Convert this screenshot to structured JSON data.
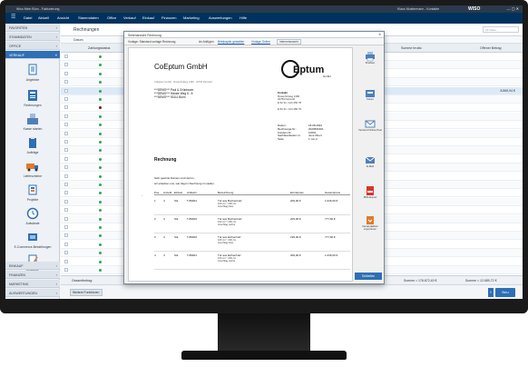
{
  "window": {
    "title": "Wiso Mein Büro - Fakturierung",
    "user": "Klaus Mustermann - Kontakte",
    "brand": "WISO",
    "controls": "— ▢ ✕"
  },
  "menu": [
    "Datei",
    "Aktuell",
    "Ansicht",
    "Stammdaten",
    "Office",
    "Verkauf",
    "Einkauf",
    "Finanzen",
    "Marketing",
    "Auswertungen",
    "Hilfe"
  ],
  "sidebar": {
    "sections": [
      "FAVORITEN",
      "STAMMDATEN",
      "OFFICE",
      "VERKAUF",
      "EINKAUF",
      "FINANZEN",
      "MARKETING",
      "AUSWERTUNGEN"
    ],
    "items": [
      "Angebote",
      "Rechnungen",
      "Kasse starten",
      "Aufträge",
      "Lieferscheine",
      "Projekte",
      "Aufwände",
      "E-Commerce-Bestellungen",
      "Entwurfe"
    ]
  },
  "main": {
    "title": "Rechnungen",
    "search_placeholder": "Alt-Taste...",
    "columns": [
      "Datum",
      "Zahlungsstatus",
      "Summe brutto",
      "Offener Betrag"
    ],
    "rows": [
      {
        "a1": "",
        "a2": ""
      },
      {
        "a1": "",
        "a2": ""
      },
      {
        "a1": "",
        "a2": ""
      },
      {
        "a1": "",
        "a2": ""
      },
      {
        "a1": "",
        "a2": "8.869,94 €"
      },
      {
        "a1": "",
        "a2": ""
      },
      {
        "a1": "",
        "a2": ""
      },
      {
        "a1": "",
        "a2": ""
      },
      {
        "a1": "",
        "a2": ""
      },
      {
        "a1": "",
        "a2": ""
      },
      {
        "a1": "",
        "a2": ""
      },
      {
        "a1": "",
        "a2": ""
      },
      {
        "a1": "",
        "a2": ""
      },
      {
        "a1": "",
        "a2": ""
      },
      {
        "a1": "",
        "a2": ""
      },
      {
        "a1": "",
        "a2": ""
      },
      {
        "a1": "",
        "a2": ""
      },
      {
        "a1": "",
        "a2": ""
      },
      {
        "a1": "",
        "a2": ""
      },
      {
        "a1": "",
        "a2": ""
      },
      {
        "a1": "",
        "a2": ""
      },
      {
        "a1": "",
        "a2": ""
      },
      {
        "a1": "",
        "a2": ""
      },
      {
        "a1": "",
        "a2": ""
      },
      {
        "a1": "",
        "a2": ""
      },
      {
        "a1": "",
        "a2": ""
      }
    ],
    "footer_left": "Gesamtbetrag:",
    "footer_sum1": "Summe = 176.672,40 €",
    "footer_sum2": "Summe = 12.689,72 €",
    "more_functions": "Weitere Funktionen",
    "new_button": "Neu"
  },
  "modal": {
    "title": "Seitenansicht Rechnung",
    "close": "✕",
    "toolbar": {
      "template_label": "Vorlage: Standard-vorlage Rechnung",
      "attachments": "An Anfügen",
      "link1": "Briefpapier gestalten",
      "link2": "Vorlage Online",
      "view_select": "Internetansicht"
    },
    "doc": {
      "company": "CoEptum GmbH",
      "logo_text": "Eptum",
      "logo_sub": "GmbH",
      "sender_line": "CoEptum GmbH · Rosenhofweg 1396 · 32760 Detmold",
      "address": [
        "***DEMO*** Paul & Grünbaum",
        "***DEMO*** Hänsle Weg 8 - 8",
        "***DEMO*** 53111 Bonn"
      ],
      "contact_title": "Kontakt:",
      "contact_lines": [
        "Rosenhofweg 1396",
        "32760 Detmold",
        "E 52 31 / 123 456 78",
        "",
        "E 52 31 / 123 456 79"
      ],
      "meta": [
        {
          "k": "Datum:",
          "v": "18.08.2022"
        },
        {
          "k": "Rechnungs-Nr.:",
          "v": "2020501601"
        },
        {
          "k": "Kunden-Nr.:",
          "v": "10001"
        },
        {
          "k": "Sachbearbeiter/-in:",
          "v": "Jens Oberl"
        },
        {
          "k": "Seite",
          "v": "1 von 2"
        }
      ],
      "heading": "Rechnung",
      "salutation": "Sehr geehrte Damen und Herren,",
      "intro": "wir erlauben uns, wie folgt in Rechnung zu stellen.",
      "table_headers": [
        "Pos.",
        "Anzahl",
        "Einheit",
        "Artikelnr.",
        "Bezeichnung",
        "Einzelpreis",
        "Gesamtpreis"
      ],
      "lines": [
        {
          "pos": "1",
          "qty": "4",
          "unit": "Stk",
          "art": "T-89001",
          "desc": "Tür aus Buchenholz",
          "sub1": "160 cm * 200 cm",
          "sub2": "Anschlag links",
          "price": "209,00 €",
          "total": "1.036,00 €"
        },
        {
          "pos": "2",
          "qty": "4",
          "unit": "Stk",
          "art": "T-89002",
          "desc": "Tür aus Buchenholz",
          "sub1": "160 cm * 200 cm",
          "sub2": "Anschlag rechts",
          "price": "209,00 €",
          "total": "777,60 €"
        },
        {
          "pos": "3",
          "qty": "4",
          "unit": "Stk",
          "art": "T-89002",
          "desc": "Tür aus Eichenholz",
          "sub1": "160 cm * 200 cm",
          "sub2": "Anschlag links",
          "price": "195,00 €",
          "total": "777,60 €"
        },
        {
          "pos": "4",
          "qty": "4",
          "unit": "Stk",
          "art": "T-89001",
          "desc": "Tür aus Eichenholz",
          "sub1": "160 cm * 200 cm",
          "sub2": "Anschlag rechts",
          "price": "309,00 €",
          "total": "1.036,00 €"
        }
      ]
    },
    "actions": [
      "Drucken",
      "Faxen",
      "Versand Online-Post",
      "E-Mail",
      "PDF-Export",
      "Versandaktion exportieren"
    ],
    "close_button": "Schließen"
  },
  "colors": {
    "menubar": "#00325f",
    "accent": "#2e6fb5",
    "status_green": "#2fa84f"
  }
}
